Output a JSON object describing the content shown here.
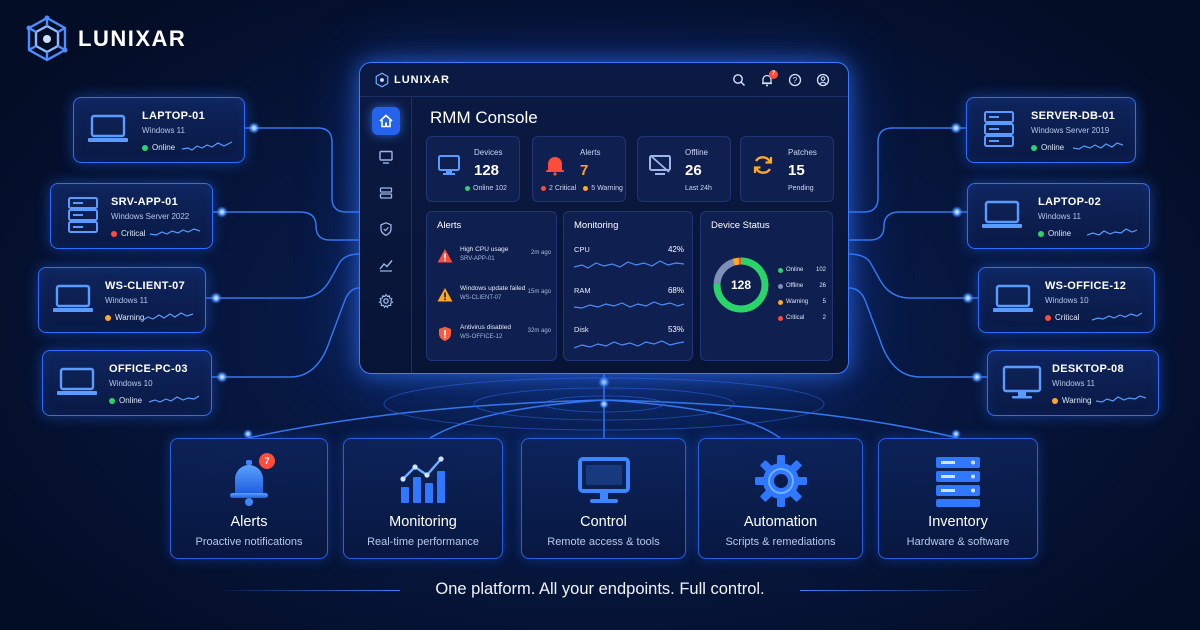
{
  "brand": {
    "name": "LUNIXAR"
  },
  "devices_left": [
    {
      "name": "LAPTOP-01",
      "os": "Windows 11",
      "status": "Online",
      "status_color": "#2bd46b",
      "icon": "laptop-icon"
    },
    {
      "name": "SRV-APP-01",
      "os": "Windows Server 2022",
      "status": "Critical",
      "status_color": "#ff4b3a",
      "icon": "server-icon"
    },
    {
      "name": "WS-CLIENT-07",
      "os": "Windows 11",
      "status": "Warning",
      "status_color": "#ffa726",
      "icon": "laptop-icon"
    },
    {
      "name": "OFFICE-PC-03",
      "os": "Windows 10",
      "status": "Online",
      "status_color": "#2bd46b",
      "icon": "laptop-icon"
    }
  ],
  "devices_right": [
    {
      "name": "SERVER-DB-01",
      "os": "Windows Server 2019",
      "status": "Online",
      "status_color": "#2bd46b",
      "icon": "server-icon"
    },
    {
      "name": "LAPTOP-02",
      "os": "Windows 11",
      "status": "Online",
      "status_color": "#2bd46b",
      "icon": "laptop-icon"
    },
    {
      "name": "WS-OFFICE-12",
      "os": "Windows 10",
      "status": "Critical",
      "status_color": "#ff4b3a",
      "icon": "laptop-icon"
    },
    {
      "name": "DESKTOP-08",
      "os": "Windows 11",
      "status": "Warning",
      "status_color": "#ffa726",
      "icon": "monitor-icon"
    }
  ],
  "console": {
    "logo": "LUNIXAR",
    "notification_count": "7",
    "title": "RMM Console",
    "stats": {
      "devices": {
        "label": "Devices",
        "value": "128",
        "sub": "Online 102"
      },
      "alerts": {
        "label": "Alerts",
        "value": "7",
        "critical": "2 Critical",
        "warning": "5 Warning"
      },
      "offline": {
        "label": "Offline",
        "value": "26",
        "sub": "Last 24h"
      },
      "patches": {
        "label": "Patches",
        "value": "15",
        "sub": "Pending"
      }
    },
    "alerts_panel": {
      "title": "Alerts",
      "items": [
        {
          "text": "High CPU usage",
          "host": "SRV-APP-01",
          "time": "2m ago",
          "icon": "warning-triangle-red-icon"
        },
        {
          "text": "Windows update failed",
          "host": "WS-CLIENT-07",
          "time": "15m ago",
          "icon": "warning-triangle-orange-icon"
        },
        {
          "text": "Antivirus disabled",
          "host": "WS-OFFICE-12",
          "time": "32m ago",
          "icon": "shield-alert-icon"
        }
      ]
    },
    "monitoring_panel": {
      "title": "Monitoring",
      "metrics": [
        {
          "label": "CPU",
          "value": "42%"
        },
        {
          "label": "RAM",
          "value": "68%"
        },
        {
          "label": "Disk",
          "value": "53%"
        }
      ]
    },
    "status_panel": {
      "title": "Device Status",
      "total": "128",
      "legend": [
        {
          "label": "Online",
          "value": 102,
          "color": "#2bd46b"
        },
        {
          "label": "Offline",
          "value": 26,
          "color": "#7d8fb8"
        },
        {
          "label": "Warning",
          "value": 5,
          "color": "#ffa726"
        },
        {
          "label": "Critical",
          "value": 2,
          "color": "#ff4b3a"
        }
      ]
    }
  },
  "features": [
    {
      "title": "Alerts",
      "subtitle": "Proactive notifications",
      "icon": "bell-icon",
      "badge": "7"
    },
    {
      "title": "Monitoring",
      "subtitle": "Real-time performance",
      "icon": "bar-chart-icon"
    },
    {
      "title": "Control",
      "subtitle": "Remote access & tools",
      "icon": "monitor-icon"
    },
    {
      "title": "Automation",
      "subtitle": "Scripts & remediations",
      "icon": "gear-icon"
    },
    {
      "title": "Inventory",
      "subtitle": "Hardware & software",
      "icon": "server-stack-icon"
    }
  ],
  "tagline": "One platform. All your endpoints. Full control.",
  "colors": {
    "accent": "#2f6cff",
    "online": "#2bd46b",
    "warning": "#ffa726",
    "critical": "#ff4b3a"
  }
}
